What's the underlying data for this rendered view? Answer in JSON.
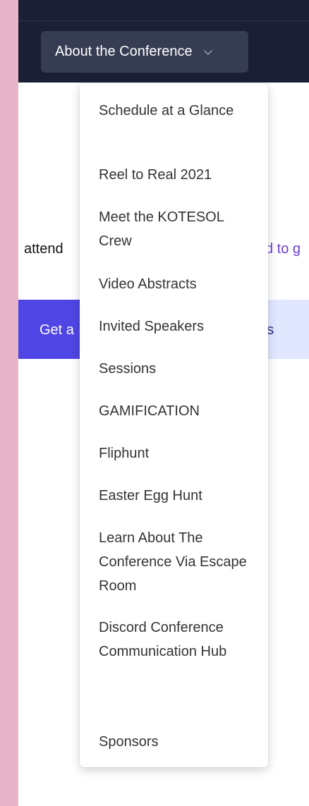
{
  "nav": {
    "button_label": "About the Conference",
    "chevron_icon": "chevron-down-icon"
  },
  "content": {
    "text_left": "attend",
    "link_right": "d to g",
    "cta_primary": "Get a",
    "cta_secondary": "t us"
  },
  "dropdown": {
    "items": [
      "Schedule at a Glance",
      "Reel to Real 2021",
      "Meet the KOTESOL Crew",
      "Video Abstracts",
      "Invited Speakers",
      "Sessions",
      "GAMIFICATION",
      "Fliphunt",
      "Easter Egg Hunt",
      "Learn About The Conference Via Escape Room",
      "Discord Conference Communication Hub",
      "Sponsors"
    ]
  },
  "colors": {
    "navbar": "#1a1f36",
    "nav_button": "#363c52",
    "cta_primary": "#4f46e5",
    "cta_secondary": "#e0e7ff",
    "link": "#6d3fd6",
    "page_frame": "#e8b4c8"
  }
}
